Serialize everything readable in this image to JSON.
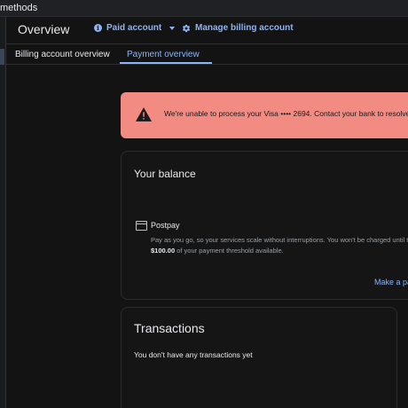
{
  "crumb": {
    "text": "methods"
  },
  "header": {
    "title": "Overview",
    "paid_account": "Paid account",
    "manage_billing": "Manage billing account"
  },
  "tabs": [
    {
      "label": "Billing account overview",
      "active": false
    },
    {
      "label": "Payment overview",
      "active": true
    }
  ],
  "alert": {
    "text": "We're unable to process your Visa •••• 2694. Contact your bank to resolve the i"
  },
  "balance": {
    "title": "Your balance",
    "plan": "Postpay",
    "desc_line1": "Pay as you go, so your services scale without interruptions. You won't be charged until th",
    "desc_amount": "$100.00",
    "desc_line2_rest": " of your payment threshold available.",
    "make_payment": "Make a pa"
  },
  "transactions": {
    "title": "Transactions",
    "empty_text": "You don't have any transactions yet"
  },
  "colors": {
    "accent": "#8ab4f8",
    "alert_bg": "#f28b82",
    "background": "#131313"
  }
}
